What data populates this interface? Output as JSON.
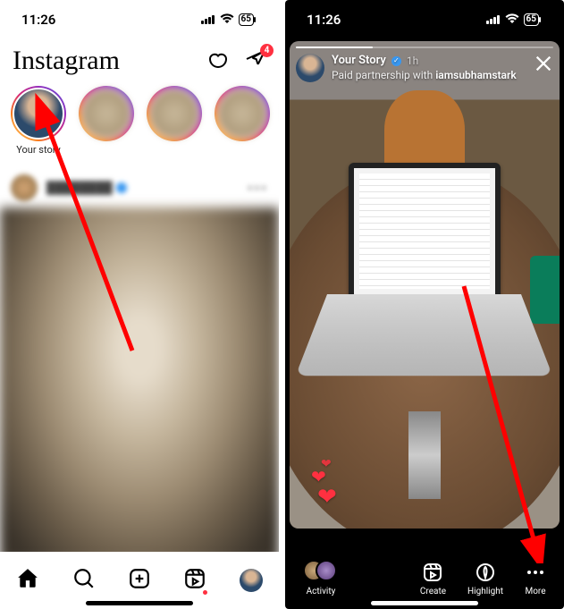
{
  "statusbar": {
    "time": "11:26",
    "battery": "65"
  },
  "left": {
    "logo": "Instagram",
    "messages_badge": "4",
    "your_story_label": "Your story",
    "pagination_active_index": 0
  },
  "right": {
    "story_title": "Your Story",
    "story_time": "1h",
    "paid_prefix": "Paid partnership with ",
    "partner": "iamsubhamstark",
    "footer": {
      "activity": "Activity",
      "create": "Create",
      "highlight": "Highlight",
      "more": "More"
    }
  }
}
